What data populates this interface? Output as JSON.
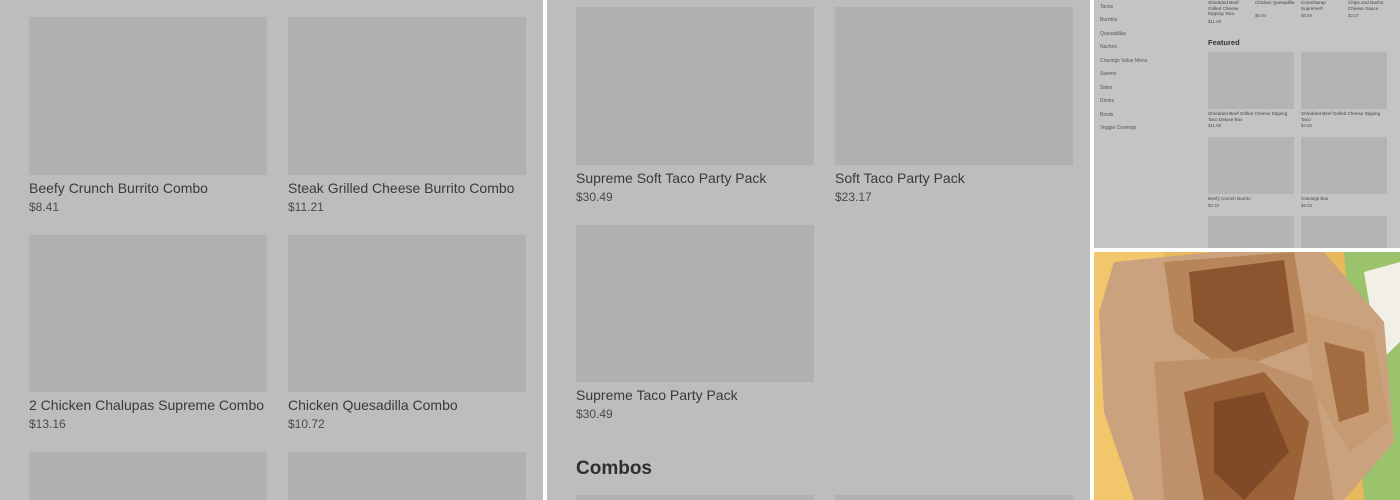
{
  "panel1": {
    "items": [
      {
        "name": "Beefy Crunch Burrito Combo",
        "price": "$8.41"
      },
      {
        "name": "Steak Grilled Cheese Burrito Combo",
        "price": "$11.21"
      },
      {
        "name": "2 Chicken Chalupas Supreme Combo",
        "price": "$13.16"
      },
      {
        "name": "Chicken Quesadilla Combo",
        "price": "$10.72"
      }
    ]
  },
  "panel2": {
    "items": [
      {
        "name": "Supreme Soft Taco Party Pack",
        "price": "$30.49"
      },
      {
        "name": "Soft Taco Party Pack",
        "price": "$23.17"
      },
      {
        "name": "Supreme Taco Party Pack",
        "price": "$30.49"
      }
    ],
    "section_heading": "Combos"
  },
  "panel3": {
    "nav": [
      "Tacos",
      "Burritos",
      "Quesadillas",
      "Nachos",
      "Cravings Value Menu",
      "Sweets",
      "Sides",
      "Drinks",
      "Bowls",
      "Veggie Cravings"
    ],
    "top_items": [
      {
        "name": "Shredded Beef Grilled Cheese Dipping Taco",
        "price": "$11.59"
      },
      {
        "name": "Chicken Quesadilla",
        "price": "$6.94"
      },
      {
        "name": "Crunchwrap Supreme®",
        "price": "$6.59"
      },
      {
        "name": "Chips and Nacho Cheese Sauce",
        "price": "$2.07"
      }
    ],
    "featured_heading": "Featured",
    "featured": [
      {
        "name": "Shredded Beef Grilled Cheese Dipping Taco Deluxe Box",
        "price": "$11.59"
      },
      {
        "name": "Shredded Beef Grilled Cheese Dipping Taco",
        "price": "$4.50"
      },
      {
        "name": "Beefy Crunch Burrito",
        "price": "$3.33"
      },
      {
        "name": "Cravings Box",
        "price": "$6.03"
      }
    ]
  },
  "colors": {
    "overlay": "#bdbdbd",
    "tile": "#b0b0b0",
    "photo_bg": "#e8b35a"
  }
}
